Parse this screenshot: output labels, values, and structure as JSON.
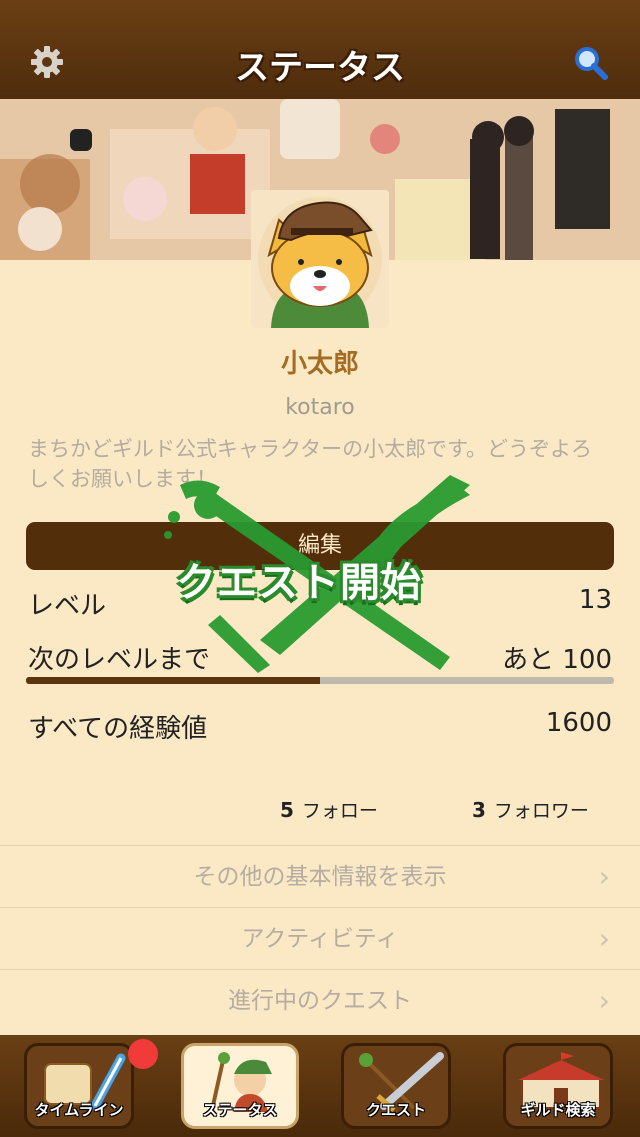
{
  "header": {
    "title": "ステータス",
    "left_icon": "gear-icon",
    "right_icon": "search-icon"
  },
  "profile": {
    "name": "小太郎",
    "user_id": "kotaro",
    "bio": "まちかどギルド公式キャラクターの小太郎です。どうぞよろしくお願いします！",
    "edit_label": "編集"
  },
  "stats": {
    "level_label": "レベル",
    "level_value": "13",
    "next_label": "次のレベルまで",
    "next_value": "あと 100",
    "progress": 0.5,
    "total_label": "すべての経験値",
    "total_value": "1600"
  },
  "social": {
    "follow_count": "5",
    "follow_label": "フォロー",
    "follower_count": "3",
    "follower_label": "フォロワー"
  },
  "menu": [
    {
      "label": "その他の基本情報を表示"
    },
    {
      "label": "アクティビティ"
    },
    {
      "label": "進行中のクエスト"
    }
  ],
  "overlay": {
    "text": "クエスト開始"
  },
  "tabs": [
    {
      "label": "タイムライン",
      "icon": "scroll-quill-icon"
    },
    {
      "label": "ステータス",
      "icon": "character-icon"
    },
    {
      "label": "クエスト",
      "icon": "sword-staff-icon"
    },
    {
      "label": "ギルド検索",
      "icon": "guild-building-icon"
    }
  ],
  "colors": {
    "header": "#4e2c0c",
    "background": "#fbe9c6",
    "accent": "#a56b22",
    "overlay_green": "#2a8a2c",
    "badge": "#f13a3a"
  }
}
